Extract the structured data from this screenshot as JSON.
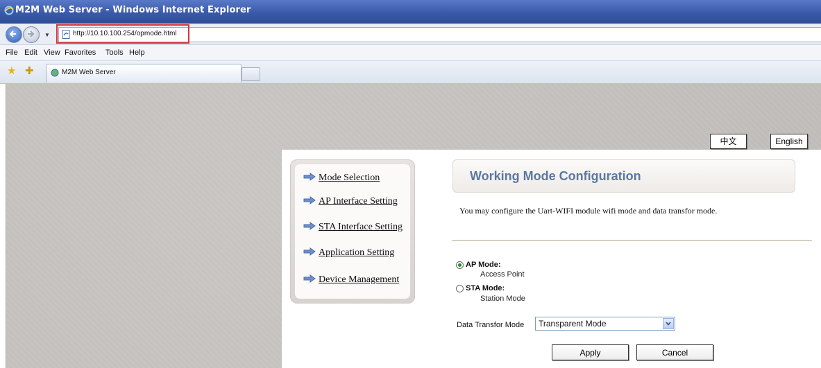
{
  "window": {
    "title": "M2M Web Server - Windows Internet Explorer",
    "icon": "ie-icon"
  },
  "address_bar": {
    "url": "http://10.10.100.254/opmode.html",
    "highlight_color": "#d9343a"
  },
  "menu": {
    "items": [
      "File",
      "Edit",
      "View",
      "Favorites",
      "Tools",
      "Help"
    ]
  },
  "tabs": [
    {
      "label": "M2M Web Server",
      "icon": "m2m-favicon"
    }
  ],
  "language": {
    "chinese": "中文",
    "english": "English"
  },
  "sidebar": {
    "items": [
      {
        "label": "Mode Selection"
      },
      {
        "label": "AP Interface Setting"
      },
      {
        "label": "STA Interface Setting"
      },
      {
        "label": "Application Setting"
      },
      {
        "label": "Device Management"
      }
    ]
  },
  "content": {
    "title": "Working Mode Configuration",
    "title_color": "#5b77a2",
    "description": "You may configure the Uart-WIFI module wifi mode and data transfor mode.",
    "modes": [
      {
        "label": "AP Mode:",
        "sub": "Access Point",
        "checked": true
      },
      {
        "label": "STA Mode:",
        "sub": "Station Mode",
        "checked": false
      }
    ],
    "data_mode_label": "Data Transfor Mode",
    "data_mode_value": "Transparent Mode",
    "apply": "Apply",
    "cancel": "Cancel"
  }
}
